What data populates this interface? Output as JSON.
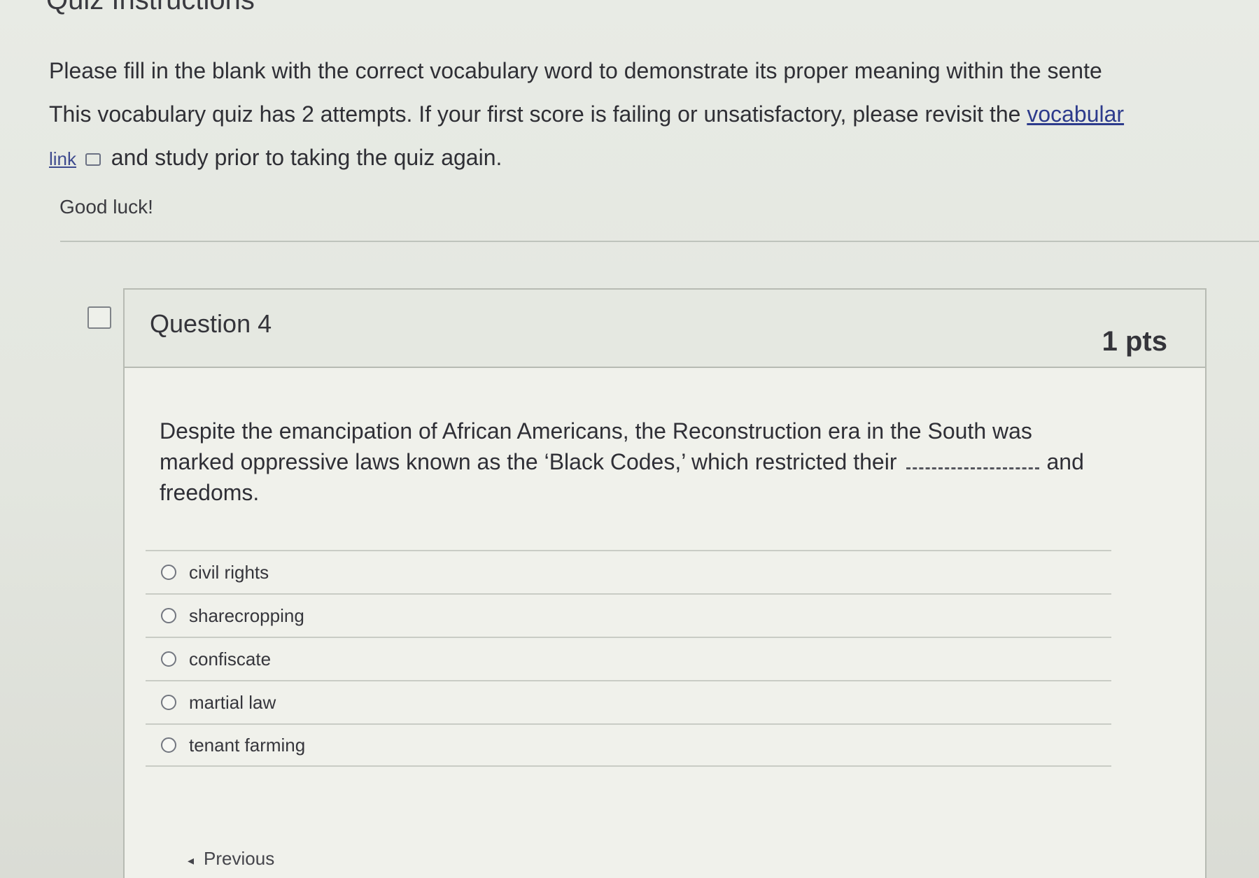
{
  "page": {
    "title": "Quiz Instructions"
  },
  "instructions": {
    "line1": "Please fill in the blank with the correct vocabulary word to demonstrate its proper meaning within the sente",
    "line2_start": "This vocabulary quiz has 2 attempts. If your first score is failing or unsatisfactory, please revisit the ",
    "line2_link": "vocabular",
    "line3_link": "link",
    "line3_rest": " and study prior to taking the quiz again.",
    "good_luck": "Good luck!"
  },
  "question": {
    "title": "Question 4",
    "points": "1 pts",
    "text_line1": "Despite the emancipation of African Americans, the Reconstruction era in the South was",
    "text_line2_start": "marked oppressive laws known as the ‘Black Codes,’ which restricted their",
    "text_line2_end": "and",
    "text_line3": "freedoms.",
    "answers": [
      {
        "label": "civil rights"
      },
      {
        "label": "sharecropping"
      },
      {
        "label": "confiscate"
      },
      {
        "label": "martial law"
      },
      {
        "label": "tenant farming"
      }
    ]
  },
  "navigation": {
    "previous_label": "Previous"
  },
  "icons": {
    "flag": "flag-icon",
    "external_link": "external-link-icon",
    "radio": "radio-icon",
    "previous_arrow": "left-arrow-icon"
  },
  "colors": {
    "link": "#2d3b8c",
    "background": "#e3e6df",
    "card": "#f0f1eb"
  }
}
